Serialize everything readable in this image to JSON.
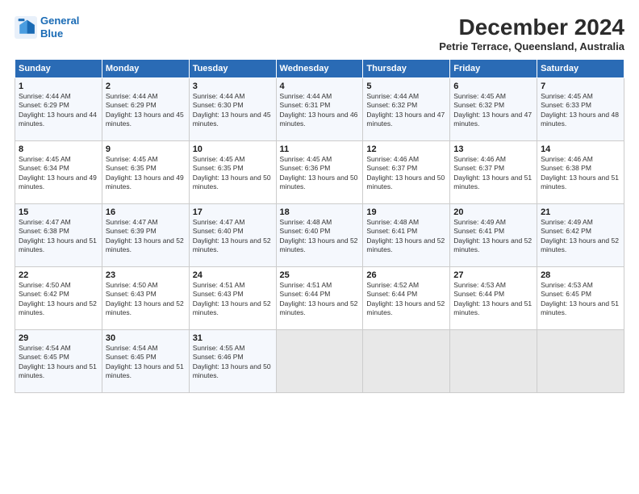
{
  "logo": {
    "line1": "General",
    "line2": "Blue"
  },
  "title": "December 2024",
  "subtitle": "Petrie Terrace, Queensland, Australia",
  "days_of_week": [
    "Sunday",
    "Monday",
    "Tuesday",
    "Wednesday",
    "Thursday",
    "Friday",
    "Saturday"
  ],
  "weeks": [
    [
      {
        "day": "1",
        "sunrise": "4:44 AM",
        "sunset": "6:29 PM",
        "daylight": "13 hours and 44 minutes."
      },
      {
        "day": "2",
        "sunrise": "4:44 AM",
        "sunset": "6:29 PM",
        "daylight": "13 hours and 45 minutes."
      },
      {
        "day": "3",
        "sunrise": "4:44 AM",
        "sunset": "6:30 PM",
        "daylight": "13 hours and 45 minutes."
      },
      {
        "day": "4",
        "sunrise": "4:44 AM",
        "sunset": "6:31 PM",
        "daylight": "13 hours and 46 minutes."
      },
      {
        "day": "5",
        "sunrise": "4:44 AM",
        "sunset": "6:32 PM",
        "daylight": "13 hours and 47 minutes."
      },
      {
        "day": "6",
        "sunrise": "4:45 AM",
        "sunset": "6:32 PM",
        "daylight": "13 hours and 47 minutes."
      },
      {
        "day": "7",
        "sunrise": "4:45 AM",
        "sunset": "6:33 PM",
        "daylight": "13 hours and 48 minutes."
      }
    ],
    [
      {
        "day": "8",
        "sunrise": "4:45 AM",
        "sunset": "6:34 PM",
        "daylight": "13 hours and 49 minutes."
      },
      {
        "day": "9",
        "sunrise": "4:45 AM",
        "sunset": "6:35 PM",
        "daylight": "13 hours and 49 minutes."
      },
      {
        "day": "10",
        "sunrise": "4:45 AM",
        "sunset": "6:35 PM",
        "daylight": "13 hours and 50 minutes."
      },
      {
        "day": "11",
        "sunrise": "4:45 AM",
        "sunset": "6:36 PM",
        "daylight": "13 hours and 50 minutes."
      },
      {
        "day": "12",
        "sunrise": "4:46 AM",
        "sunset": "6:37 PM",
        "daylight": "13 hours and 50 minutes."
      },
      {
        "day": "13",
        "sunrise": "4:46 AM",
        "sunset": "6:37 PM",
        "daylight": "13 hours and 51 minutes."
      },
      {
        "day": "14",
        "sunrise": "4:46 AM",
        "sunset": "6:38 PM",
        "daylight": "13 hours and 51 minutes."
      }
    ],
    [
      {
        "day": "15",
        "sunrise": "4:47 AM",
        "sunset": "6:38 PM",
        "daylight": "13 hours and 51 minutes."
      },
      {
        "day": "16",
        "sunrise": "4:47 AM",
        "sunset": "6:39 PM",
        "daylight": "13 hours and 52 minutes."
      },
      {
        "day": "17",
        "sunrise": "4:47 AM",
        "sunset": "6:40 PM",
        "daylight": "13 hours and 52 minutes."
      },
      {
        "day": "18",
        "sunrise": "4:48 AM",
        "sunset": "6:40 PM",
        "daylight": "13 hours and 52 minutes."
      },
      {
        "day": "19",
        "sunrise": "4:48 AM",
        "sunset": "6:41 PM",
        "daylight": "13 hours and 52 minutes."
      },
      {
        "day": "20",
        "sunrise": "4:49 AM",
        "sunset": "6:41 PM",
        "daylight": "13 hours and 52 minutes."
      },
      {
        "day": "21",
        "sunrise": "4:49 AM",
        "sunset": "6:42 PM",
        "daylight": "13 hours and 52 minutes."
      }
    ],
    [
      {
        "day": "22",
        "sunrise": "4:50 AM",
        "sunset": "6:42 PM",
        "daylight": "13 hours and 52 minutes."
      },
      {
        "day": "23",
        "sunrise": "4:50 AM",
        "sunset": "6:43 PM",
        "daylight": "13 hours and 52 minutes."
      },
      {
        "day": "24",
        "sunrise": "4:51 AM",
        "sunset": "6:43 PM",
        "daylight": "13 hours and 52 minutes."
      },
      {
        "day": "25",
        "sunrise": "4:51 AM",
        "sunset": "6:44 PM",
        "daylight": "13 hours and 52 minutes."
      },
      {
        "day": "26",
        "sunrise": "4:52 AM",
        "sunset": "6:44 PM",
        "daylight": "13 hours and 52 minutes."
      },
      {
        "day": "27",
        "sunrise": "4:53 AM",
        "sunset": "6:44 PM",
        "daylight": "13 hours and 51 minutes."
      },
      {
        "day": "28",
        "sunrise": "4:53 AM",
        "sunset": "6:45 PM",
        "daylight": "13 hours and 51 minutes."
      }
    ],
    [
      {
        "day": "29",
        "sunrise": "4:54 AM",
        "sunset": "6:45 PM",
        "daylight": "13 hours and 51 minutes."
      },
      {
        "day": "30",
        "sunrise": "4:54 AM",
        "sunset": "6:45 PM",
        "daylight": "13 hours and 51 minutes."
      },
      {
        "day": "31",
        "sunrise": "4:55 AM",
        "sunset": "6:46 PM",
        "daylight": "13 hours and 50 minutes."
      },
      null,
      null,
      null,
      null
    ]
  ]
}
